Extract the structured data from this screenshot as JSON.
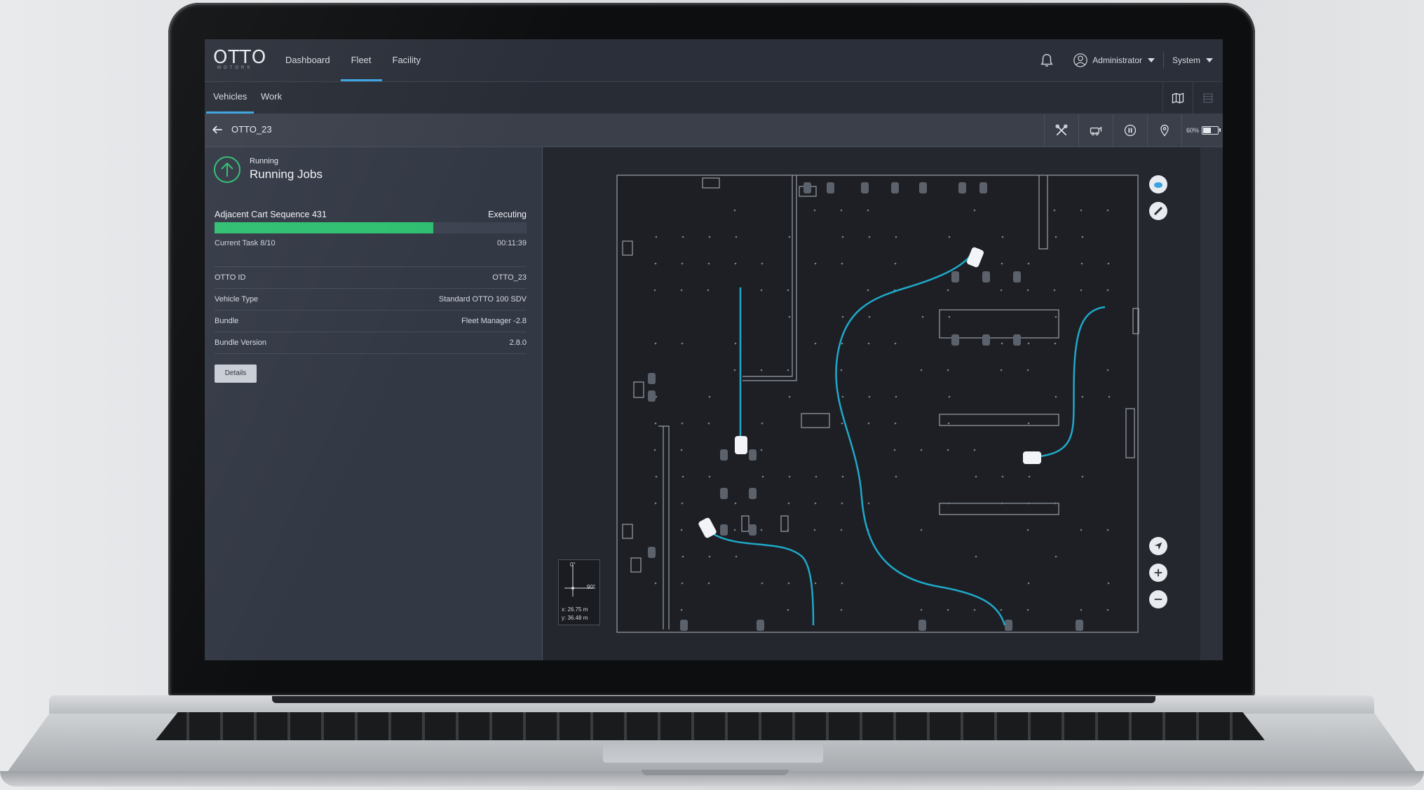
{
  "app": {
    "logo": "OTTO",
    "logo_sub": "MOTORS"
  },
  "nav": {
    "items": [
      {
        "label": "Dashboard"
      },
      {
        "label": "Fleet"
      },
      {
        "label": "Facility"
      }
    ],
    "active": "Fleet"
  },
  "header": {
    "user": "Administrator",
    "system": "System"
  },
  "subtabs": {
    "vehicles": "Vehicles",
    "work": "Work",
    "active": "Vehicles"
  },
  "vehicle": {
    "name": "OTTO_23",
    "battery_label": "60%",
    "battery_level": 0.6
  },
  "status": {
    "small": "Running",
    "big": "Running Jobs",
    "accent": "#2fbf71"
  },
  "job": {
    "name": "Adjacent Cart Sequence 431",
    "state": "Executing",
    "progress": 0.7,
    "task": "Current Task 8/10",
    "elapsed": "00:11:39"
  },
  "info": [
    {
      "key": "OTTO ID",
      "value": "OTTO_23"
    },
    {
      "key": "Vehicle Type",
      "value": "Standard OTTO 100 SDV"
    },
    {
      "key": "Bundle",
      "value": "Fleet Manager -2.8"
    },
    {
      "key": "Bundle Version",
      "value": "2.8.0"
    }
  ],
  "details_button": "Details",
  "compass": {
    "north": "0°",
    "east": "90°",
    "x": "x: 26.75 m",
    "y": "y: 36.48 m"
  },
  "colors": {
    "accent": "#3aa3e0",
    "path": "#1fa8c9",
    "progress": "#2fbf71"
  }
}
